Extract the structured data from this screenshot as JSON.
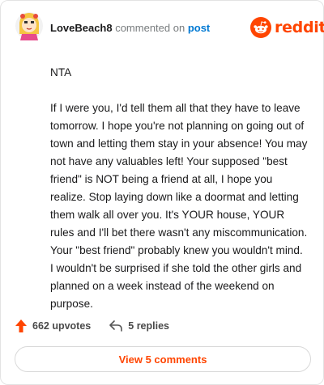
{
  "comment": {
    "username": "LoveBeach8",
    "action_text": " commented on ",
    "post_link": "post",
    "paragraphs": [
      "NTA",
      "If I were you, I'd tell them all that they have to leave tomorrow. I hope you're not planning on going out of town and letting them stay in your absence! You may not have any valuables left! Your supposed \"best friend\" is NOT being a friend at all, I hope you realize. Stop laying down like a doormat and letting them walk all over you. It's YOUR house, YOUR rules and I'll bet there wasn't any miscommunication. Your \"best friend\" probably knew you wouldn't mind. I wouldn't be surprised if she told the other girls and planned on a week instead of the weekend on purpose."
    ],
    "upvotes": "662 upvotes",
    "replies": "5 replies",
    "view_comments": "View 5 comments"
  },
  "brand": {
    "name": "reddit",
    "color": "#ff4500"
  },
  "icons": {
    "avatar": "avatar-icon",
    "logo": "reddit-logo-icon",
    "upvote": "upvote-arrow-icon",
    "reply": "reply-arrow-icon"
  }
}
